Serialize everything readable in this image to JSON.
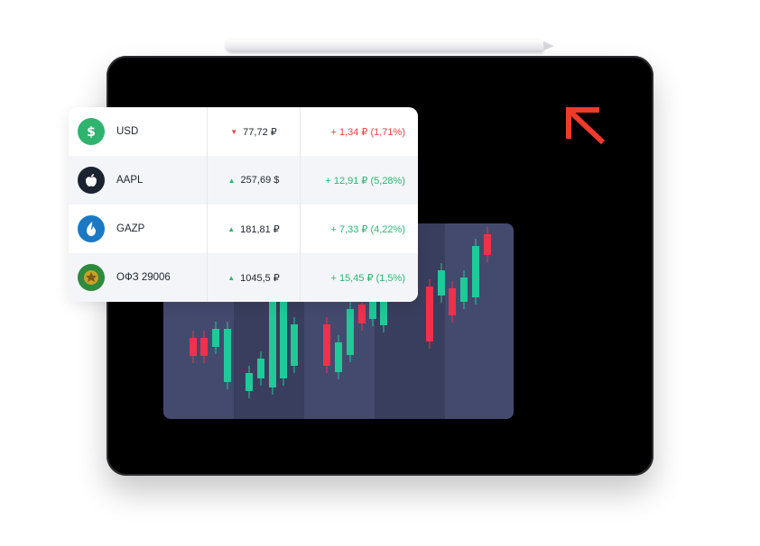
{
  "colors": {
    "tablet": "#000000",
    "panel": "#444a6e",
    "panel_dark": "#3a3f5f",
    "up": "#2bb673",
    "down": "#ef3e42",
    "candle_up": "#20c997",
    "candle_down": "#f0314d",
    "logo": "#ef3b2c"
  },
  "logo_icon": "arrow-up-left-icon",
  "quotes": [
    {
      "ticker": "USD",
      "icon": "dollar-icon",
      "icon_color": "#2fb36e",
      "price": "77,72 ₽",
      "direction": "down",
      "change": "+ 1,34 ₽ (1,71%)"
    },
    {
      "ticker": "AAPL",
      "icon": "apple-icon",
      "icon_color": "#1b2230",
      "price": "257,69 $",
      "direction": "up",
      "change": "+ 12,91 ₽ (5,28%)"
    },
    {
      "ticker": "GAZP",
      "icon": "gazprom-flame-icon",
      "icon_color": "#1b79c4",
      "price": "181,81 ₽",
      "direction": "up",
      "change": "+ 7,33 ₽ (4,22%)"
    },
    {
      "ticker": "ОФЗ 29006",
      "icon": "emblem-icon",
      "icon_color": "#2f8a3e",
      "price": "1045,5 ₽",
      "direction": "up",
      "change": "+ 15,45 ₽ (1,5%)"
    }
  ]
}
